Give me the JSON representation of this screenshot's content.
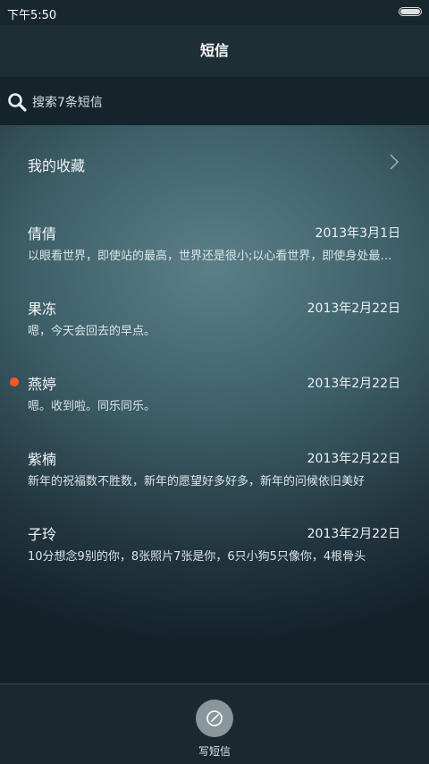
{
  "status": {
    "time": "下午5:50"
  },
  "header": {
    "title": "短信"
  },
  "search": {
    "text": "搜索7条短信"
  },
  "favorites": {
    "label": "我的收藏"
  },
  "messages": [
    {
      "name": "倩倩",
      "date": "2013年3月1日",
      "preview": "以眼看世界，即使站的最高，世界还是很小;以心看世界，即使身处最低处，世界也很大",
      "unread": false
    },
    {
      "name": "果冻",
      "date": "2013年2月22日",
      "preview": "嗯，今天会回去的早点。",
      "unread": false
    },
    {
      "name": "燕婷",
      "date": "2013年2月22日",
      "preview": "嗯。收到啦。同乐同乐。",
      "unread": true
    },
    {
      "name": "紫楠",
      "date": "2013年2月22日",
      "preview": "新年的祝福数不胜数，新年的愿望好多好多，新年的问候依旧美好",
      "unread": false
    },
    {
      "name": "子玲",
      "date": "2013年2月22日",
      "preview": "10分想念9别的你，8张照片7张是你，6只小狗5只像你，4根骨头",
      "unread": false
    }
  ],
  "bottom": {
    "compose_label": "写短信"
  },
  "colors": {
    "unread_dot": "#ff5a1f",
    "background": "#1c2b33"
  }
}
